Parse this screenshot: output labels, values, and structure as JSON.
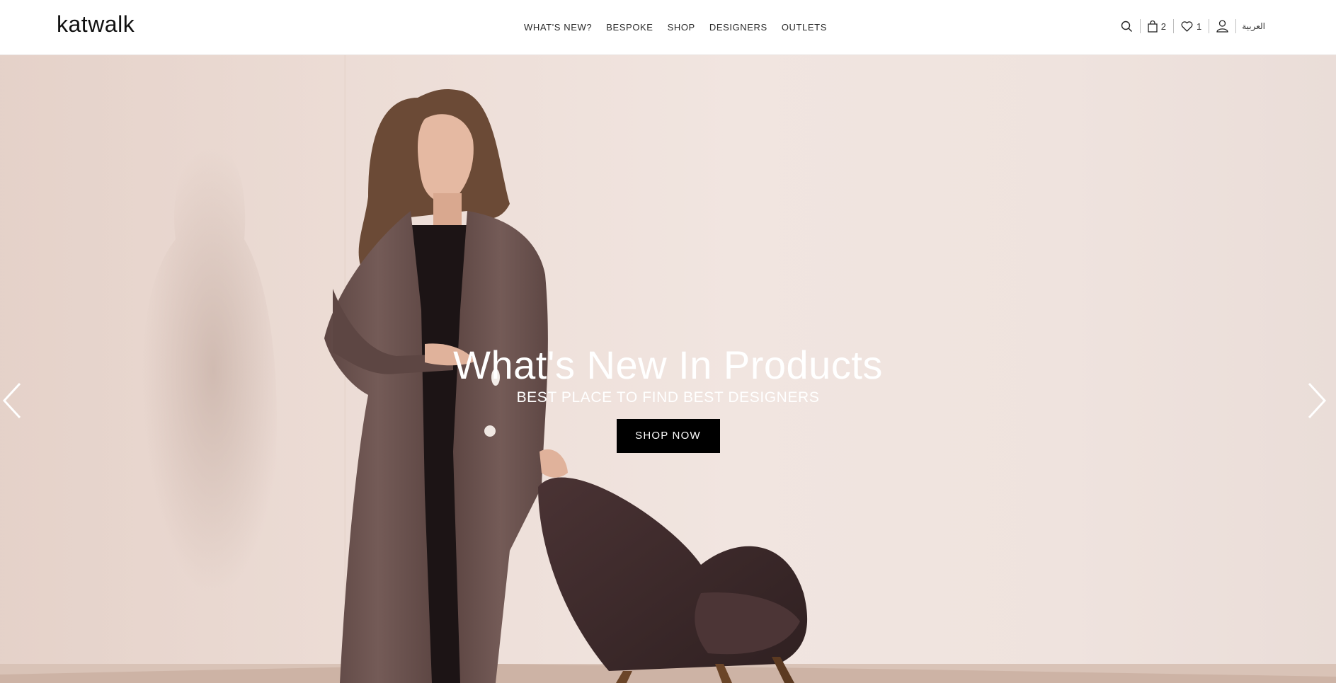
{
  "brand": {
    "logo": "katwalk"
  },
  "nav": [
    {
      "label": "WHAT'S NEW?"
    },
    {
      "label": "BESPOKE"
    },
    {
      "label": "SHOP"
    },
    {
      "label": "DESIGNERS"
    },
    {
      "label": "OUTLETS"
    }
  ],
  "header_actions": {
    "search_icon": "search-icon",
    "cart_count": "2",
    "wishlist_count": "1",
    "account_icon": "user-icon",
    "language": "العربية"
  },
  "hero": {
    "title": "What's New In Products",
    "subtitle": "BEST PLACE TO FIND BEST DESIGNERS",
    "cta": "SHOP NOW",
    "prev_icon": "chevron-left-icon",
    "next_icon": "chevron-right-icon"
  },
  "colors": {
    "header_bg": "#ffffff",
    "hero_bg": "#efe2dc",
    "robe": "#6e5552",
    "chair": "#3e2b2c",
    "button_bg": "#000000"
  }
}
